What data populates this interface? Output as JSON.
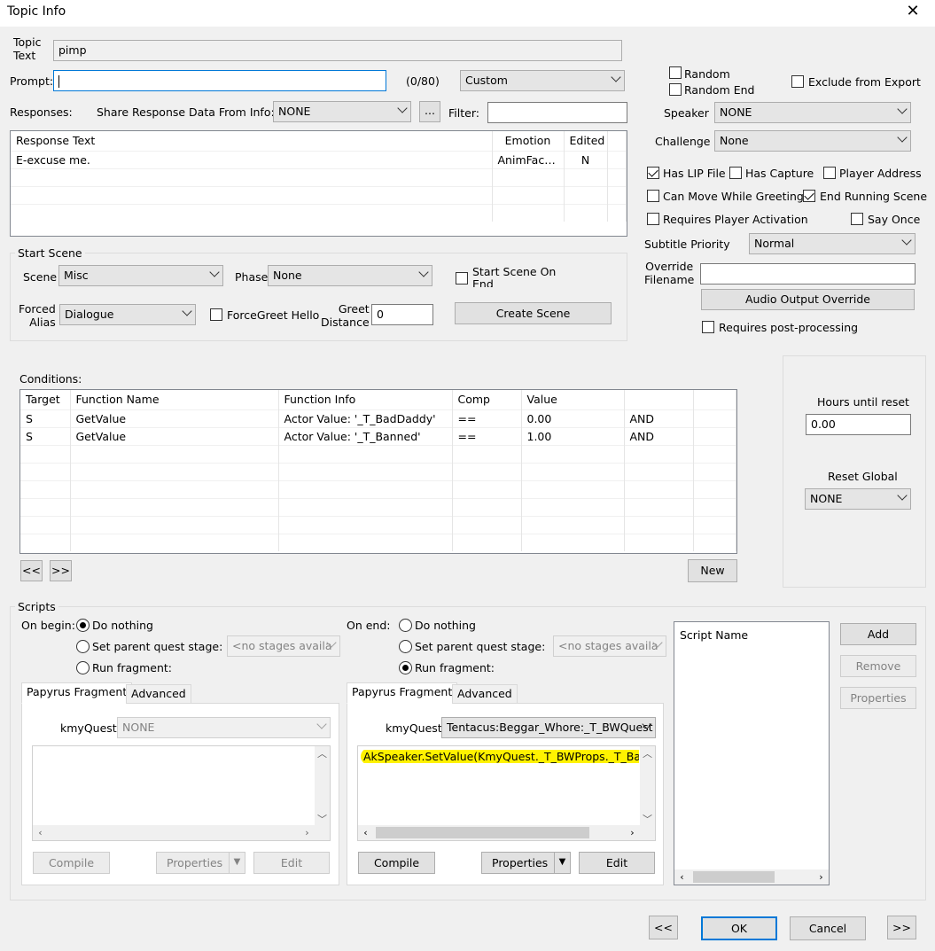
{
  "window": {
    "title": "Topic Info",
    "close_glyph": "✕"
  },
  "topic": {
    "label": "Topic\nText",
    "value": "pimp"
  },
  "prompt": {
    "label": "Prompt:",
    "value": "",
    "count": "(0/80)",
    "type": "Custom"
  },
  "responses": {
    "label": "Responses:",
    "share_label": "Share Response Data From Info:",
    "share_value": "NONE",
    "ellipsis": "...",
    "filter_label": "Filter:",
    "filter_value": "",
    "columns": [
      "Response Text",
      "Emotion",
      "Edited"
    ],
    "rows": [
      [
        "E-excuse me.",
        "AnimFace...",
        "N"
      ]
    ]
  },
  "start_scene": {
    "title": "Start Scene",
    "scene_label": "Scene",
    "scene_value": "Misc",
    "phase_label": "Phase",
    "phase_value": "None",
    "start_on_end_label": "Start Scene On End",
    "forced_alias_label": "Forced\nAlias",
    "forced_alias_value": "Dialogue",
    "forcegreet_label": "ForceGreet Hello",
    "greet_label": "Greet\nDistance",
    "greet_value": "0",
    "create_label": "Create Scene"
  },
  "right_panel": {
    "random": "Random",
    "random_end": "Random End",
    "exclude": "Exclude from Export",
    "speaker_label": "Speaker",
    "speaker_value": "NONE",
    "challenge_label": "Challenge",
    "challenge_value": "None",
    "has_lip": "Has LIP File",
    "has_capture": "Has Capture",
    "player_address": "Player Address",
    "can_move": "Can Move While Greeting",
    "end_running": "End Running Scene",
    "requires_activation": "Requires Player Activation",
    "say_once": "Say Once",
    "subtitle_label": "Subtitle Priority",
    "subtitle_value": "Normal",
    "override_label": "Override\nFilename",
    "override_value": "",
    "audio_override": "Audio Output Override",
    "post_processing": "Requires post-processing"
  },
  "conditions": {
    "label": "Conditions:",
    "columns": [
      "Target",
      "Function Name",
      "Function Info",
      "Comp",
      "Value",
      ""
    ],
    "rows": [
      [
        "S",
        "GetValue",
        "Actor Value: '_T_BadDaddy'",
        "==",
        "0.00",
        "AND"
      ],
      [
        "S",
        "GetValue",
        "Actor Value: '_T_Banned'",
        "==",
        "1.00",
        "AND"
      ]
    ],
    "prev": "<<",
    "next": ">>",
    "new": "New"
  },
  "reset": {
    "hours_label": "Hours until reset",
    "hours_value": "0.00",
    "global_label": "Reset Global",
    "global_value": "NONE"
  },
  "scripts": {
    "title": "Scripts",
    "on_begin": "On begin:",
    "on_end": "On end:",
    "do_nothing": "Do nothing",
    "set_stage": "Set parent quest stage:",
    "run_fragment": "Run fragment:",
    "no_stages": "<no stages availa",
    "tab_papyrus": "Papyrus Fragment",
    "tab_advanced": "Advanced",
    "kmyquest_label": "kmyQuest",
    "begin_kmyquest": "NONE",
    "end_kmyquest": "Tentacus:Beggar_Whore:_T_BWQuest",
    "end_code": "AkSpeaker.SetValue(KmyQuest._T_BWProps._T_Banned",
    "compile": "Compile",
    "properties": "Properties",
    "edit": "Edit",
    "script_name_header": "Script Name",
    "add": "Add",
    "remove": "Remove",
    "props": "Properties"
  },
  "footer": {
    "prev": "<<",
    "ok": "OK",
    "cancel": "Cancel",
    "next": ">>"
  }
}
